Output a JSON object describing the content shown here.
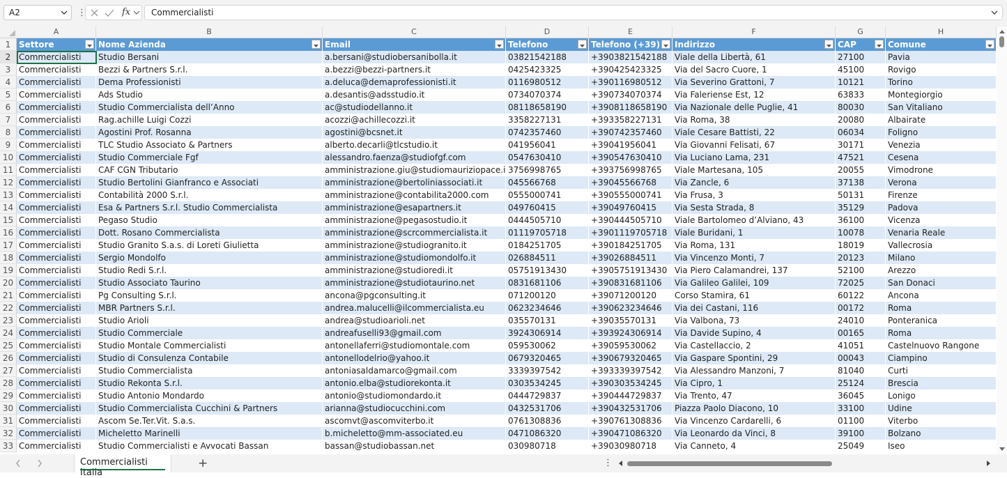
{
  "formula_bar": {
    "name_box": "A2",
    "content": "Commercialisti"
  },
  "columns": [
    "A",
    "B",
    "C",
    "D",
    "E",
    "F",
    "G",
    "H"
  ],
  "headers": [
    "Settore",
    "Nome Azienda",
    "Email",
    "Telefono",
    "Telefono (+39)",
    "Indirizzo",
    "CAP",
    "Comune"
  ],
  "rows": [
    [
      "Commercialisti",
      "Studio Bersani",
      "a.bersani@studiobersanibolla.it",
      "03821542188",
      "+3903821542188",
      "Viale della Libertà, 61",
      "27100",
      "Pavia"
    ],
    [
      "Commercialisti",
      "Bezzi & Partners S.r.l.",
      "a.bezzi@bezzi-partners.it",
      "0425423325",
      "+390425423325",
      "Via del Sacro Cuore, 1",
      "45100",
      "Rovigo"
    ],
    [
      "Commercialisti",
      "Dema Professionisti",
      "a.deluca@demaprofessionisti.it",
      "0116980512",
      "+390116980512",
      "Via Severino Grattoni, 7",
      "10121",
      "Torino"
    ],
    [
      "Commercialisti",
      "Ads Studio",
      "a.desantis@adsstudio.it",
      "0734070374",
      "+390734070374",
      "Via Faleriense Est, 12",
      "63833",
      "Montegiorgio"
    ],
    [
      "Commercialisti",
      "Studio Commercialista dell’Anno",
      "ac@studiodellanno.it",
      "08118658190",
      "+3908118658190",
      "Via Nazionale delle Puglie, 41",
      "80030",
      "San Vitaliano"
    ],
    [
      "Commercialisti",
      "Rag.achille Luigi Cozzi",
      "acozzi@achillecozzi.it",
      "3358227131",
      "+393358227131",
      "Via Roma, 38",
      "20080",
      "Albairate"
    ],
    [
      "Commercialisti",
      "Agostini Prof. Rosanna",
      "agostini@bcsnet.it",
      "0742357460",
      "+390742357460",
      "Viale Cesare Battisti, 22",
      "06034",
      "Foligno"
    ],
    [
      "Commercialisti",
      "TLC Studio Associato & Partners",
      "alberto.decarli@tlcstudio.it",
      "041956041",
      "+39041956041",
      "Via Giovanni Felisati, 67",
      "30171",
      "Venezia"
    ],
    [
      "Commercialisti",
      "Studio Commerciale Fgf",
      "alessandro.faenza@studiofgf.com",
      "0547630410",
      "+390547630410",
      "Via Luciano Lama, 231",
      "47521",
      "Cesena"
    ],
    [
      "Commercialisti",
      "CAF CGN Tributario",
      "amministrazione.giu@studiomauriziopace.it",
      "3756998765",
      "+393756998765",
      "Viale Martesana, 105",
      "20055",
      "Vimodrone"
    ],
    [
      "Commercialisti",
      "Studio Bertolini Gianfranco e Associati",
      "amministrazione@bertoliniassociati.it",
      "045566768",
      "+39045566768",
      "Via Zancle, 6",
      "37138",
      "Verona"
    ],
    [
      "Commercialisti",
      "Contabilità 2000 S.r.l.",
      "amministrazione@contabilita2000.com",
      "0555000741",
      "+390555000741",
      "Via Frusa, 3",
      "50131",
      "Firenze"
    ],
    [
      "Commercialisti",
      "Esa & Partners S.r.l. Studio Commercialista",
      "amministrazione@esapartners.it",
      "049760415",
      "+39049760415",
      "Via Sesta Strada, 8",
      "35129",
      "Padova"
    ],
    [
      "Commercialisti",
      "Pegaso Studio",
      "amministrazione@pegasostudio.it",
      "0444505710",
      "+390444505710",
      "Viale Bartolomeo d’Alviano, 43",
      "36100",
      "Vicenza"
    ],
    [
      "Commercialisti",
      "Dott. Rosano Commercialista",
      "amministrazione@scrcommercialista.it",
      "01119705718",
      "+3901119705718",
      "Viale Buridani, 1",
      "10078",
      "Venaria Reale"
    ],
    [
      "Commercialisti",
      "Studio Granito S.a.s. di Loreti Giulietta",
      "amministrazione@studiogranito.it",
      "0184251705",
      "+390184251705",
      "Via Roma, 131",
      "18019",
      "Vallecrosia"
    ],
    [
      "Commercialisti",
      "Sergio Mondolfo",
      "amministrazione@studiomondolfo.it",
      "026884511",
      "+39026884511",
      "Via Vincenzo Monti, 7",
      "20123",
      "Milano"
    ],
    [
      "Commercialisti",
      "Studio Redi S.r.l.",
      "amministrazione@studioredi.it",
      "05751913430",
      "+3905751913430",
      "Via Piero Calamandrei, 137",
      "52100",
      "Arezzo"
    ],
    [
      "Commercialisti",
      "Studio Associato Taurino",
      "amministrazione@studiotaurino.net",
      "0831681106",
      "+390831681106",
      "Via Galileo Galilei, 109",
      "72025",
      "San Donaci"
    ],
    [
      "Commercialisti",
      "Pg Consulting S.r.l.",
      "ancona@pgconsulting.it",
      "071200120",
      "+39071200120",
      "Corso Stamira, 61",
      "60122",
      "Ancona"
    ],
    [
      "Commercialisti",
      "MBR Partners S.r.l.",
      "andrea.malucelli@ilcommercialista.eu",
      "0623234646",
      "+390623234646",
      "Via dei Castani, 116",
      "00172",
      "Roma"
    ],
    [
      "Commercialisti",
      "Studio Arioli",
      "andrea@studioarioli.net",
      "035570131",
      "+39035570131",
      "Via Valbona, 73",
      "24010",
      "Ponteranica"
    ],
    [
      "Commercialisti",
      "Studio Commerciale",
      "andreafuselli93@gmail.com",
      "3924306914",
      "+393924306914",
      "Via Davide Supino, 4",
      "00165",
      "Roma"
    ],
    [
      "Commercialisti",
      "Studio Montale Commercialisti",
      "antonellaferri@studiomontale.com",
      "059530062",
      "+39059530062",
      "Via Castellaccio, 2",
      "41051",
      "Castelnuovo Rangone"
    ],
    [
      "Commercialisti",
      "Studio di Consulenza Contabile",
      "antonellodelrio@yahoo.it",
      "0679320465",
      "+390679320465",
      "Via Gaspare Spontini, 29",
      "00043",
      "Ciampino"
    ],
    [
      "Commercialisti",
      "Studio Commercialista",
      "antoniasaldamarco@gmail.com",
      "3339397542",
      "+393339397542",
      "Via Alessandro Manzoni, 7",
      "81040",
      "Curti"
    ],
    [
      "Commercialisti",
      "Studio Rekonta S.r.l.",
      "antonio.elba@studiorekonta.it",
      "0303534245",
      "+390303534245",
      "Via Cipro, 1",
      "25124",
      "Brescia"
    ],
    [
      "Commercialisti",
      "Studio Antonio Mondardo",
      "antonio@studiomondardo.it",
      "0444729837",
      "+390444729837",
      "Via Trento, 47",
      "36045",
      "Lonigo"
    ],
    [
      "Commercialisti",
      "Studio Commercialista Cucchini & Partners",
      "arianna@studiocucchini.com",
      "0432531706",
      "+390432531706",
      "Piazza Paolo Diacono, 10",
      "33100",
      "Udine"
    ],
    [
      "Commercialisti",
      "Ascom Se.Ter.Vit. S.a.s.",
      "ascomvt@ascomviterbo.it",
      "0761308836",
      "+390761308836",
      "Via Vincenzo Cardarelli, 6",
      "01100",
      "Viterbo"
    ],
    [
      "Commercialisti",
      "Micheletto Marinelli",
      "b.micheletto@mm-associated.eu",
      "0471086320",
      "+390471086320",
      "Via Leonardo da Vinci, 8",
      "39100",
      "Bolzano"
    ],
    [
      "Commercialisti",
      "Studio Commercialisti e Avvocati Bassan",
      "bassan@studiobassan.net",
      "030980718",
      "+39030980718",
      "Via Canneto, 4",
      "25049",
      "Iseo"
    ]
  ],
  "sheet_tab": "Commercialisti Italia",
  "selected_cell": "A2",
  "colors": {
    "header_fill": "#5b9bd5",
    "band_fill": "#dde9f6",
    "selection": "#1e7145"
  }
}
